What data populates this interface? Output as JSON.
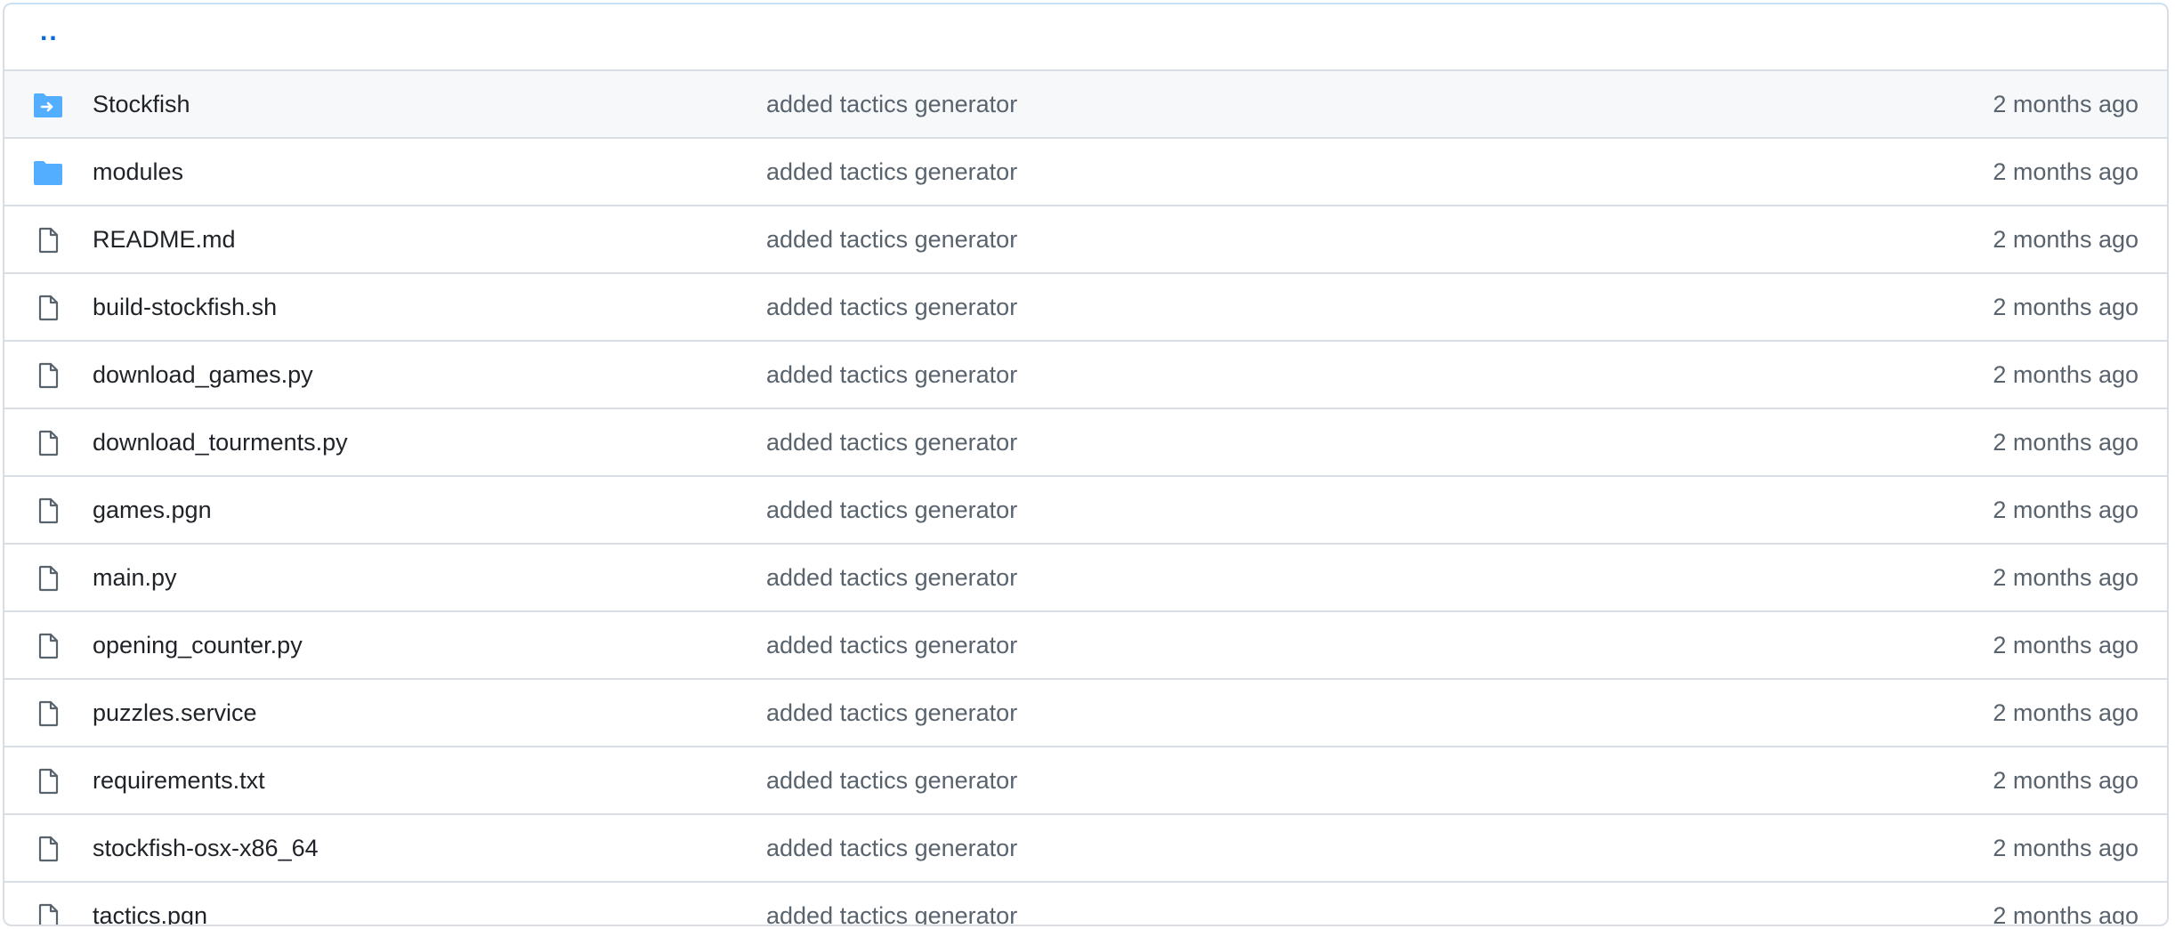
{
  "parent_link": "..",
  "colors": {
    "folder_icon": "#54aeff",
    "file_icon": "#59636e",
    "link": "#0969da",
    "row_highlight": "#f6f8fa",
    "border": "#d8dee4"
  },
  "files": [
    {
      "name": "Stockfish",
      "type": "submodule",
      "icon": "submodule-folder-icon",
      "message": "added tactics generator",
      "age": "2 months ago"
    },
    {
      "name": "modules",
      "type": "folder",
      "icon": "folder-icon",
      "message": "added tactics generator",
      "age": "2 months ago"
    },
    {
      "name": "README.md",
      "type": "file",
      "icon": "file-icon",
      "message": "added tactics generator",
      "age": "2 months ago"
    },
    {
      "name": "build-stockfish.sh",
      "type": "file",
      "icon": "file-icon",
      "message": "added tactics generator",
      "age": "2 months ago"
    },
    {
      "name": "download_games.py",
      "type": "file",
      "icon": "file-icon",
      "message": "added tactics generator",
      "age": "2 months ago"
    },
    {
      "name": "download_tourments.py",
      "type": "file",
      "icon": "file-icon",
      "message": "added tactics generator",
      "age": "2 months ago"
    },
    {
      "name": "games.pgn",
      "type": "file",
      "icon": "file-icon",
      "message": "added tactics generator",
      "age": "2 months ago"
    },
    {
      "name": "main.py",
      "type": "file",
      "icon": "file-icon",
      "message": "added tactics generator",
      "age": "2 months ago"
    },
    {
      "name": "opening_counter.py",
      "type": "file",
      "icon": "file-icon",
      "message": "added tactics generator",
      "age": "2 months ago"
    },
    {
      "name": "puzzles.service",
      "type": "file",
      "icon": "file-icon",
      "message": "added tactics generator",
      "age": "2 months ago"
    },
    {
      "name": "requirements.txt",
      "type": "file",
      "icon": "file-icon",
      "message": "added tactics generator",
      "age": "2 months ago"
    },
    {
      "name": "stockfish-osx-x86_64",
      "type": "file",
      "icon": "file-icon",
      "message": "added tactics generator",
      "age": "2 months ago"
    },
    {
      "name": "tactics.pgn",
      "type": "file",
      "icon": "file-icon",
      "message": "added tactics generator",
      "age": "2 months ago"
    }
  ]
}
